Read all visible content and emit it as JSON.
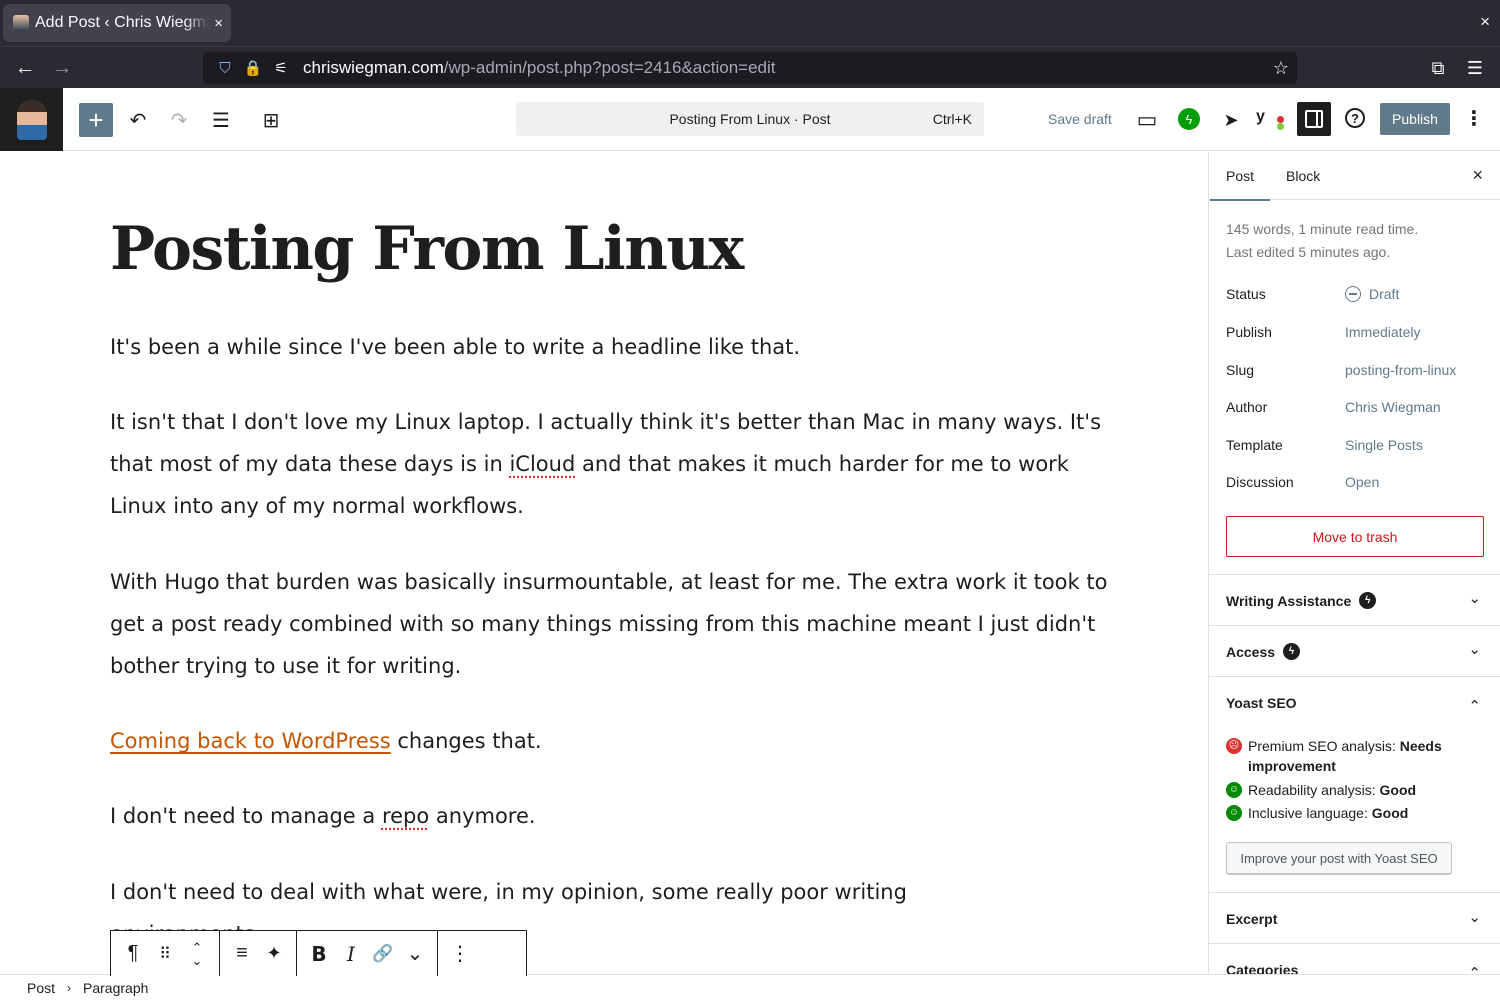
{
  "browser": {
    "tab_title": "Add Post ‹ Chris Wiegman — WordPress",
    "url_host": "chriswiegman.com",
    "url_path": "/wp-admin/post.php?post=2416&action=edit",
    "icons": {
      "tab_close": "×",
      "window_close": "×",
      "back": "←",
      "forward": "→",
      "shield": "⛉",
      "lock": "🔒",
      "permissions": "⚟",
      "bookmark_star": "☆",
      "extensions": "⧉",
      "menu": "☰"
    }
  },
  "toolbar": {
    "inserter": "+",
    "undo": "↶",
    "redo": "↷",
    "document_overview": "☰",
    "block_patterns": "⊞",
    "command_title": "Posting From Linux · Post",
    "command_shortcut": "Ctrl+K",
    "save_draft": "Save draft",
    "preview": "▭",
    "jetpack": "ϟ",
    "send": "➤",
    "yoast": "y",
    "help": "?",
    "publish": "Publish",
    "more": "⋮"
  },
  "editor": {
    "title": "Posting From Linux",
    "paragraphs": {
      "p1": "It's been a while since I've been able to write a headline like that.",
      "p2_a": "It isn't that I don't love my Linux laptop. I actually think it's better than Mac in many ways. It's that most of my data these days is in ",
      "p2_spell": "iCloud",
      "p2_b": " and that makes it much harder for me to work Linux into any of my normal workflows.",
      "p3": "With Hugo that burden was basically insurmountable, at least for me. The extra work it took to get a post ready combined with so many things missing from this machine meant I just didn't bother trying to use it for writing.",
      "p4_link": "Coming back to WordPress",
      "p4_rest": " changes that.",
      "p5_a": "I don't need to manage a ",
      "p5_spell": "repo",
      "p5_b": " anymore.",
      "p6": "I don't need to deal with what were, in my opinion, some really poor writing environments."
    }
  },
  "block_toolbar": {
    "paragraph": "¶",
    "drag": "⠿",
    "move_up": "⌃",
    "move_down": "⌄",
    "align": "≡",
    "ai": "✦",
    "bold": "B",
    "italic": "I",
    "link": "🔗",
    "more_rich": "⌄",
    "options": "⋮"
  },
  "breadcrumb": {
    "root": "Post",
    "sep": "›",
    "current": "Paragraph"
  },
  "sidebar": {
    "tabs": {
      "post": "Post",
      "block": "Block"
    },
    "close": "×",
    "word_count": "145 words, 1 minute read time.",
    "last_edited": "Last edited 5 minutes ago.",
    "rows": {
      "status_k": "Status",
      "status_v": "Draft",
      "publish_k": "Publish",
      "publish_v": "Immediately",
      "slug_k": "Slug",
      "slug_v": "posting-from-linux",
      "author_k": "Author",
      "author_v": "Chris Wiegman",
      "template_k": "Template",
      "template_v": "Single Posts",
      "discussion_k": "Discussion",
      "discussion_v": "Open"
    },
    "trash": "Move to trash",
    "panels": {
      "writing": "Writing Assistance",
      "access": "Access",
      "yoast": "Yoast SEO",
      "excerpt": "Excerpt",
      "categories": "Categories"
    },
    "jp_badge": "ϟ",
    "chev_down": "⌄",
    "chev_up": "⌃",
    "seo": {
      "premium_label": "Premium SEO analysis: ",
      "premium_value": "Needs improvement",
      "readability_label": "Readability analysis: ",
      "readability_value": "Good",
      "inclusive_label": "Inclusive language: ",
      "inclusive_value": "Good",
      "bad_face": "☹",
      "good_face": "☺"
    },
    "improve_button": "Improve your post with Yoast SEO"
  }
}
